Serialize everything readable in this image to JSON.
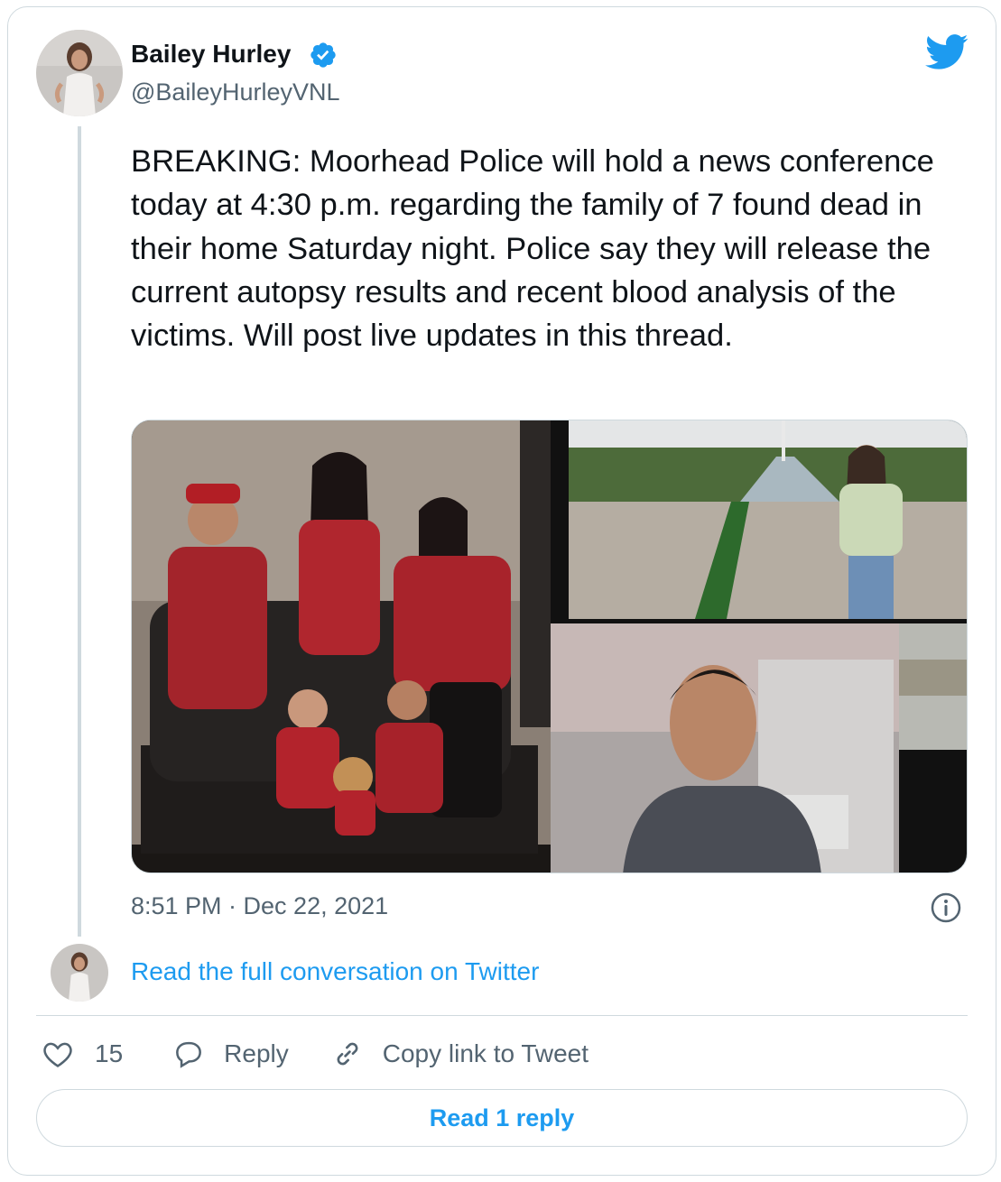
{
  "author": {
    "name": "Bailey Hurley",
    "handle": "@BaileyHurleyVNL",
    "verified_icon": "verified-badge-icon"
  },
  "tweet": {
    "text": "BREAKING: Moorhead Police will hold a news conference today at 4:30 p.m. regarding the family of 7 found dead in their home Saturday night. Police say they will release the current autopsy results and recent blood analysis of the victims. Will post live updates in this thread.",
    "timestamp": "8:51 PM · Dec 22, 2021"
  },
  "links": {
    "read_full": "Read the full conversation on Twitter"
  },
  "actions": {
    "like_count": "15",
    "reply_label": "Reply",
    "copy_link_label": "Copy link to Tweet"
  },
  "footer": {
    "read_replies": "Read 1 reply"
  },
  "colors": {
    "accent": "#1d9bf0",
    "secondary_text": "#536471",
    "border": "#cfd9de"
  }
}
